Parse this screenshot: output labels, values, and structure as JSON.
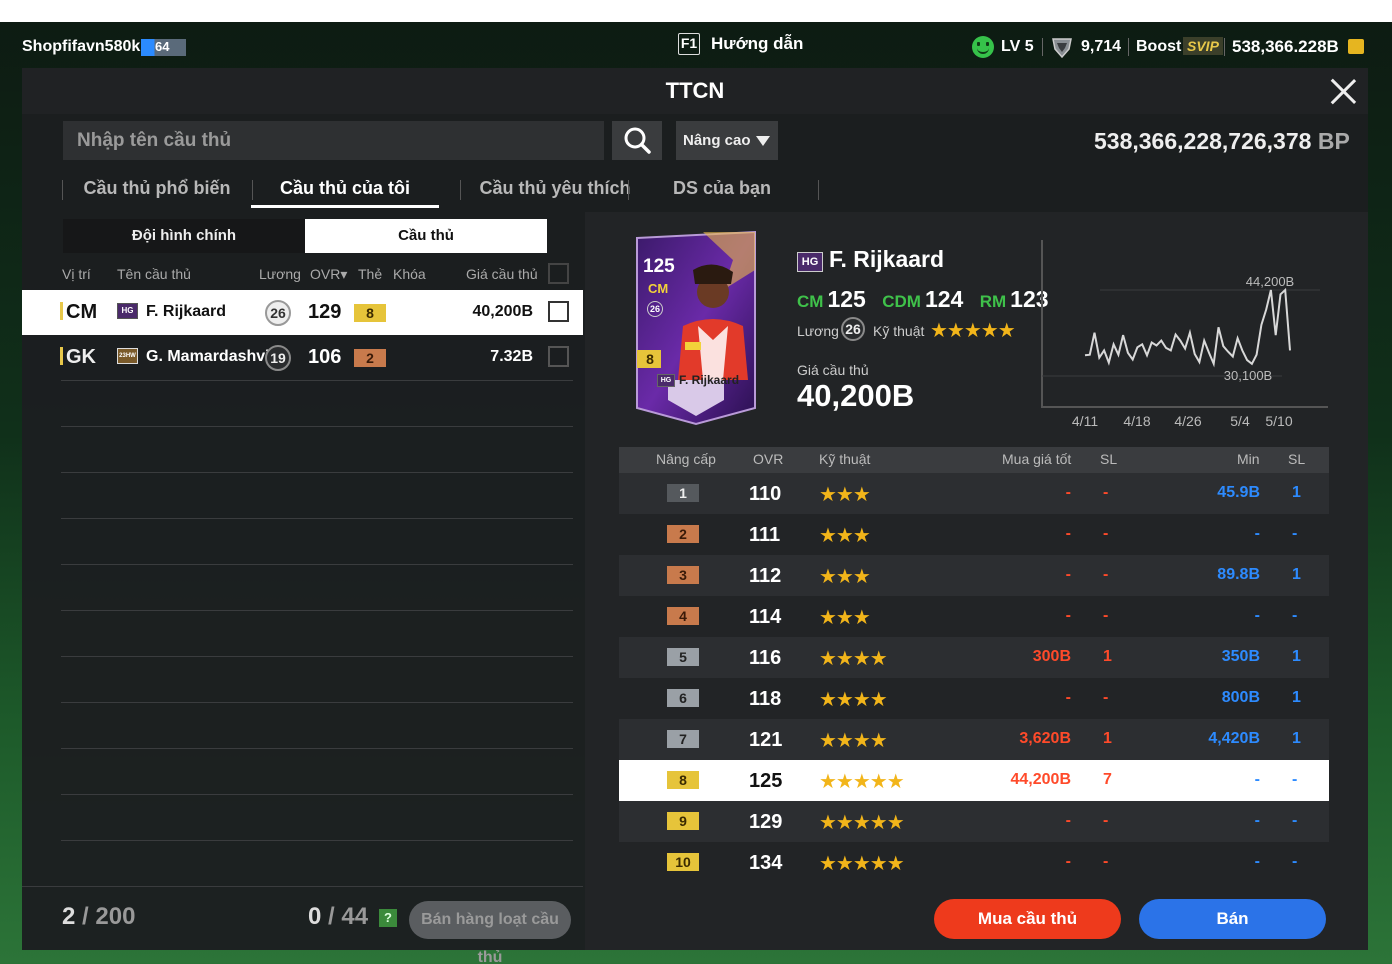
{
  "topbar": {
    "username": "Shopfifavn580k",
    "level_badge": "64",
    "f1_key": "F1",
    "guide_label": "Hướng dẫn",
    "level": "LV 5",
    "bp_small": "9,714",
    "boost": "Boost",
    "svip": "SVIP",
    "coins": "538,366.228B"
  },
  "window": {
    "title": "TTCN",
    "search_placeholder": "Nhập tên cầu thủ",
    "advanced_label": "Nâng cao",
    "bp_amount": "538,366,228,726,378",
    "bp_unit": "BP"
  },
  "tabs": [
    {
      "label": "Cầu thủ phổ biến",
      "active": false
    },
    {
      "label": "Cầu thủ của tôi",
      "active": true
    },
    {
      "label": "Cầu thủ yêu thích",
      "active": false
    },
    {
      "label": "DS của bạn",
      "active": false
    }
  ],
  "subtabs": {
    "main_squad": "Đội hình chính",
    "players": "Cầu thủ"
  },
  "list": {
    "headers": {
      "position": "Vị trí",
      "name": "Tên cầu thủ",
      "salary": "Lương",
      "ovr": "OVR▾",
      "card": "Thẻ",
      "lock": "Khóa",
      "price": "Giá cầu thủ"
    },
    "rows": [
      {
        "position": "CM",
        "season": "HG",
        "name": "F. Rijkaard",
        "salary": "26",
        "ovr": "129",
        "grade": "8",
        "price": "40,200B",
        "selected": true
      },
      {
        "position": "GK",
        "season": "23HW",
        "name": "G. Mamardashvili",
        "salary": "19",
        "ovr": "106",
        "grade": "2",
        "price": "7.32B",
        "selected": false
      }
    ],
    "count": "2",
    "count_limit": "/ 200",
    "bulk_count": "0",
    "bulk_limit": "/ 44",
    "help_label": "?",
    "bulk_sell_label": "Bán hàng loạt cầu thủ"
  },
  "detail": {
    "card": {
      "ovr": "125",
      "position": "CM",
      "salary": "26",
      "grade": "8",
      "name": "F. Rijkaard",
      "season": "HG"
    },
    "season": "HG",
    "name": "F. Rijkaard",
    "positions": [
      {
        "pos": "CM",
        "ovr": "125"
      },
      {
        "pos": "CDM",
        "ovr": "124"
      },
      {
        "pos": "RM",
        "ovr": "123"
      }
    ],
    "salary_label": "Lương",
    "salary": "26",
    "skill_label": "Kỹ thuật",
    "skill_stars": "★★★★★",
    "price_label": "Giá cầu thủ",
    "price": "40,200B"
  },
  "chart_data": {
    "type": "line",
    "x_ticks": [
      "4/11",
      "4/18",
      "4/26",
      "5/4",
      "5/10"
    ],
    "annotations": [
      "44,200B",
      "30,100B"
    ],
    "values": [
      33.5,
      33.6,
      37.2,
      33.1,
      34.3,
      32.3,
      35.3,
      33.6,
      36.8,
      33.9,
      32.8,
      34.8,
      35.3,
      33.5,
      35.6,
      35.1,
      35.9,
      34.7,
      34.3,
      36.9,
      35.9,
      34.6,
      37.2,
      33.7,
      32.4,
      35.9,
      33.9,
      32.1,
      38.1,
      35.0,
      34.1,
      33.3,
      36.3,
      34.3,
      32.7,
      32.1,
      33.6,
      38.5,
      41.0,
      44.2,
      36.8,
      43.5,
      44.2,
      34.3
    ]
  },
  "table": {
    "headers": {
      "upgrade": "Nâng cấp",
      "ovr": "OVR",
      "skill": "Kỹ thuật",
      "best_buy": "Mua giá tốt",
      "qty1": "SL",
      "min": "Min",
      "qty2": "SL"
    },
    "rows": [
      {
        "grade": "1",
        "ovr": "110",
        "stars": "★★★",
        "buy": "-",
        "buy_qty": "-",
        "min": "45.9B",
        "min_qty": "1"
      },
      {
        "grade": "2",
        "ovr": "111",
        "stars": "★★★",
        "buy": "-",
        "buy_qty": "-",
        "min": "-",
        "min_qty": "-"
      },
      {
        "grade": "3",
        "ovr": "112",
        "stars": "★★★",
        "buy": "-",
        "buy_qty": "-",
        "min": "89.8B",
        "min_qty": "1"
      },
      {
        "grade": "4",
        "ovr": "114",
        "stars": "★★★",
        "buy": "-",
        "buy_qty": "-",
        "min": "-",
        "min_qty": "-"
      },
      {
        "grade": "5",
        "ovr": "116",
        "stars": "★★★★",
        "buy": "300B",
        "buy_qty": "1",
        "min": "350B",
        "min_qty": "1"
      },
      {
        "grade": "6",
        "ovr": "118",
        "stars": "★★★★",
        "buy": "-",
        "buy_qty": "-",
        "min": "800B",
        "min_qty": "1"
      },
      {
        "grade": "7",
        "ovr": "121",
        "stars": "★★★★",
        "buy": "3,620B",
        "buy_qty": "1",
        "min": "4,420B",
        "min_qty": "1"
      },
      {
        "grade": "8",
        "ovr": "125",
        "stars": "★★★★★",
        "buy": "44,200B",
        "buy_qty": "7",
        "min": "-",
        "min_qty": "-"
      },
      {
        "grade": "9",
        "ovr": "129",
        "stars": "★★★★★",
        "buy": "-",
        "buy_qty": "-",
        "min": "-",
        "min_qty": "-"
      },
      {
        "grade": "10",
        "ovr": "134",
        "stars": "★★★★★",
        "buy": "-",
        "buy_qty": "-",
        "min": "-",
        "min_qty": "-"
      }
    ]
  },
  "actions": {
    "buy_label": "Mua cầu thủ",
    "sell_label": "Bán"
  }
}
